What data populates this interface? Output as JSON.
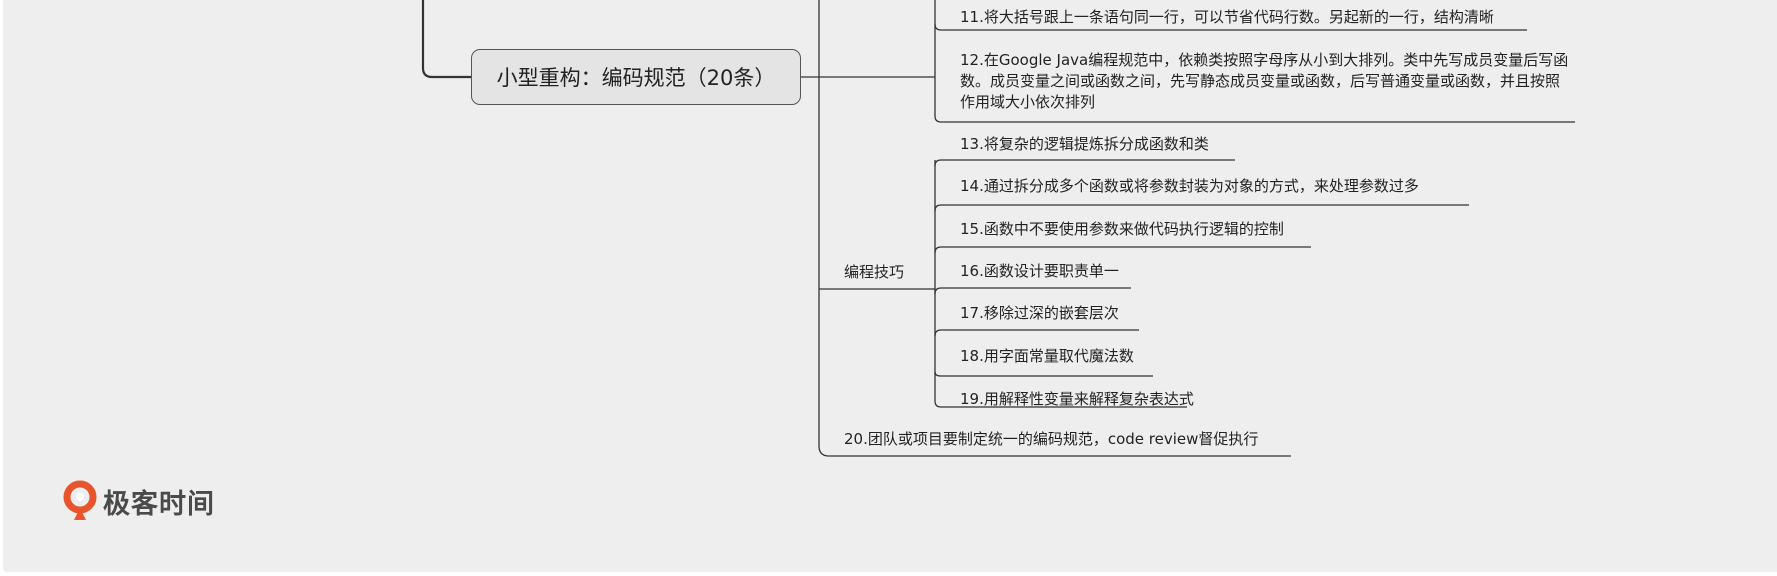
{
  "mindmap": {
    "root": {
      "label": "小型重构：编码规范（20条）"
    },
    "items": {
      "item11": "11.将大括号跟上一条语句同一行，可以节省代码行数。另起新的一行，结构清晰",
      "item12": "12.在Google Java编程规范中，依赖类按照字母序从小到大排列。类中先写成员变量后写函数。成员变量之间或函数之间，先写静态成员变量或函数，后写普通变量或函数，并且按照作用域大小依次排列",
      "group_skills": "编程技巧",
      "item13": "13.将复杂的逻辑提炼拆分成函数和类",
      "item14": "14.通过拆分成多个函数或将参数封装为对象的方式，来处理参数过多",
      "item15": "15.函数中不要使用参数来做代码执行逻辑的控制",
      "item16": "16.函数设计要职责单一",
      "item17": "17.移除过深的嵌套层次",
      "item18": "18.用字面常量取代魔法数",
      "item19": "19.用解释性变量来解释复杂表达式",
      "item20": "20.团队或项目要制定统一的编码规范，code review督促执行"
    }
  },
  "logo": {
    "text": "极客时间",
    "color": "#e8552c"
  },
  "colors": {
    "line": "#333333",
    "background": "#eeeeee"
  }
}
